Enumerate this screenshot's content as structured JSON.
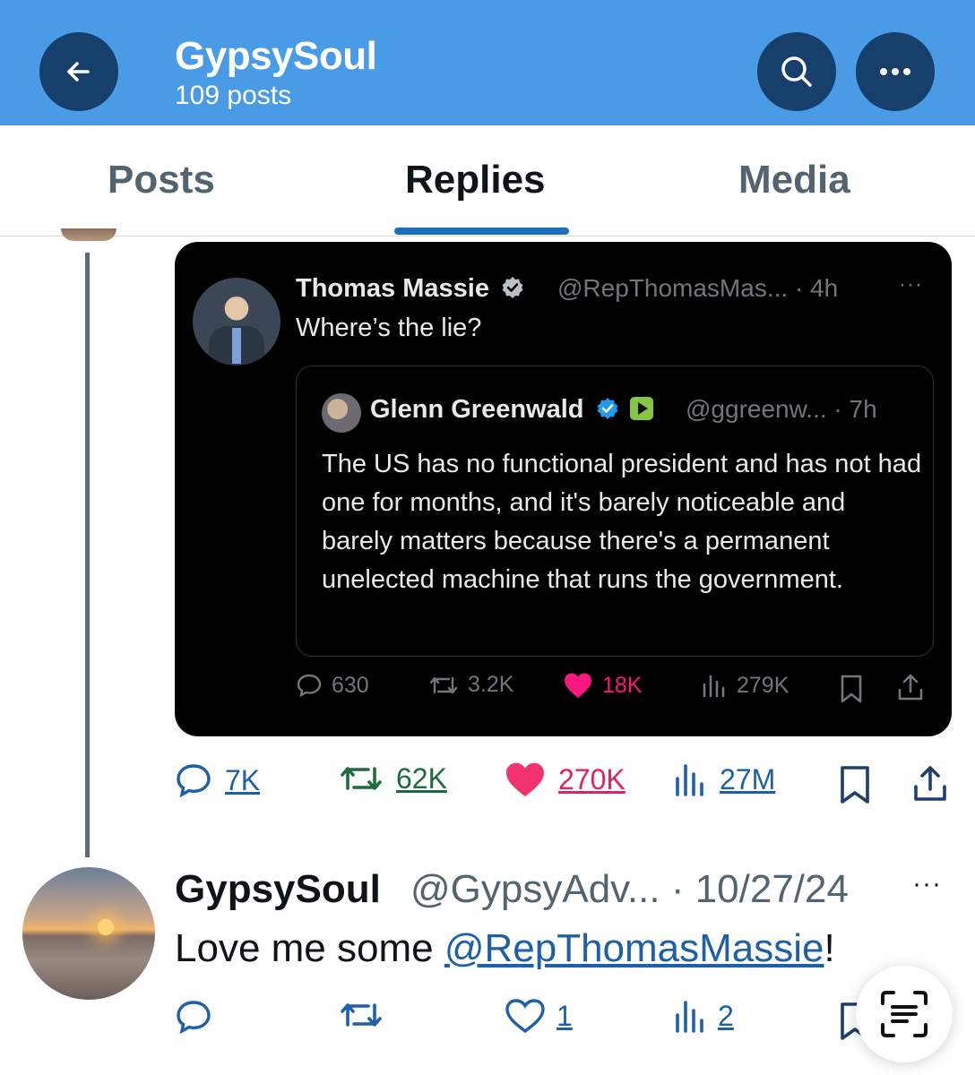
{
  "header": {
    "title": "GypsySoul",
    "subtitle": "109 posts",
    "icons": [
      "arrow-left-icon",
      "search-icon",
      "more-horizontal-icon"
    ]
  },
  "tabs": [
    {
      "label": "Posts",
      "active": false
    },
    {
      "label": "Replies",
      "active": true
    },
    {
      "label": "Media",
      "active": false
    }
  ],
  "embedded_post": {
    "author_name": "Thomas Massie",
    "author_handle": "@RepThomasMas... · 4h",
    "more": "···",
    "text": "Where’s the lie?",
    "quote": {
      "author_name": "Glenn Greenwald",
      "author_handle": "@ggreenw... · 7h",
      "text": "The US has no functional president and has not had one for months, and it's barely noticeable and barely matters because there's a permanent unelected machine that runs the government."
    },
    "stats": {
      "replies": "630",
      "reposts": "3.2K",
      "likes": "18K",
      "views": "279K"
    }
  },
  "post_stats": {
    "replies": "7K",
    "reposts": "62K",
    "likes": "270K",
    "views": "27M"
  },
  "reply": {
    "author_name": "GypsySoul",
    "author_handle": "@GypsyAdv... · 10/27/24",
    "more": "···",
    "text_prefix": "Love me some ",
    "mention": "@RepThomasMassie",
    "text_suffix": "!",
    "stats": {
      "likes": "1",
      "views": "2"
    }
  },
  "colors": {
    "header_bg": "#4a9be6",
    "header_button": "#173f6b",
    "like": "#f91880",
    "verified": "#1d9bf0"
  }
}
